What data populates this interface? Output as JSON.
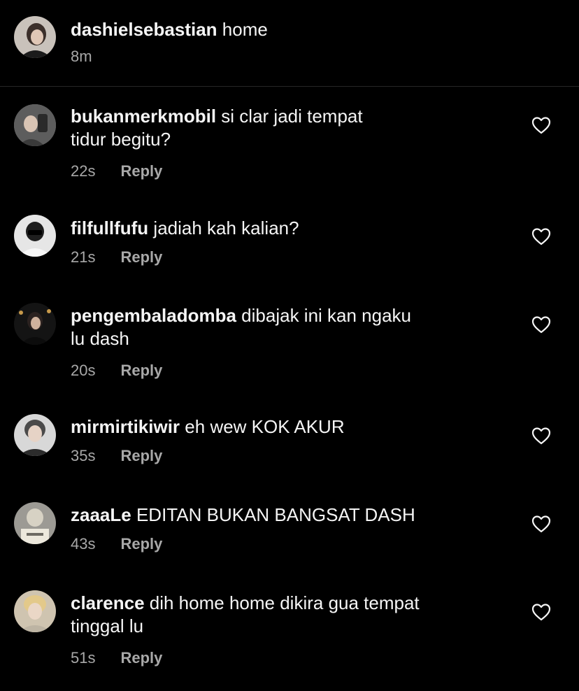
{
  "caption": {
    "username": "dashielsebastian",
    "text": "home",
    "time": "8m",
    "avatar_icon": "user-avatar"
  },
  "reply_label": "Reply",
  "like_icon": "heart-outline-icon",
  "comments": [
    {
      "username": "bukanmerkmobil",
      "line1": "si clar jadi tempat",
      "line2": "tidur begitu?",
      "time": "22s"
    },
    {
      "username": "filfullfufu",
      "line1": "jadiah kah kalian?",
      "line2": "",
      "time": "21s"
    },
    {
      "username": "pengembaladomba",
      "line1": "dibajak ini kan ngaku",
      "line2": "lu dash",
      "time": "20s"
    },
    {
      "username": "mirmirtikiwir",
      "line1": "eh wew KOK AKUR",
      "line2": "",
      "time": "35s"
    },
    {
      "username": "zaaaLe",
      "line1": "EDITAN BUKAN BANGSAT DASH",
      "line2": "",
      "time": "43s"
    },
    {
      "username": "clarence",
      "line1": "dih home home dikira gua tempat",
      "line2": "tinggal lu",
      "time": "51s"
    }
  ],
  "colors": {
    "background": "#000000",
    "text": "#f5f5f5",
    "secondary_text": "#a8a8a8",
    "divider": "#262626"
  }
}
